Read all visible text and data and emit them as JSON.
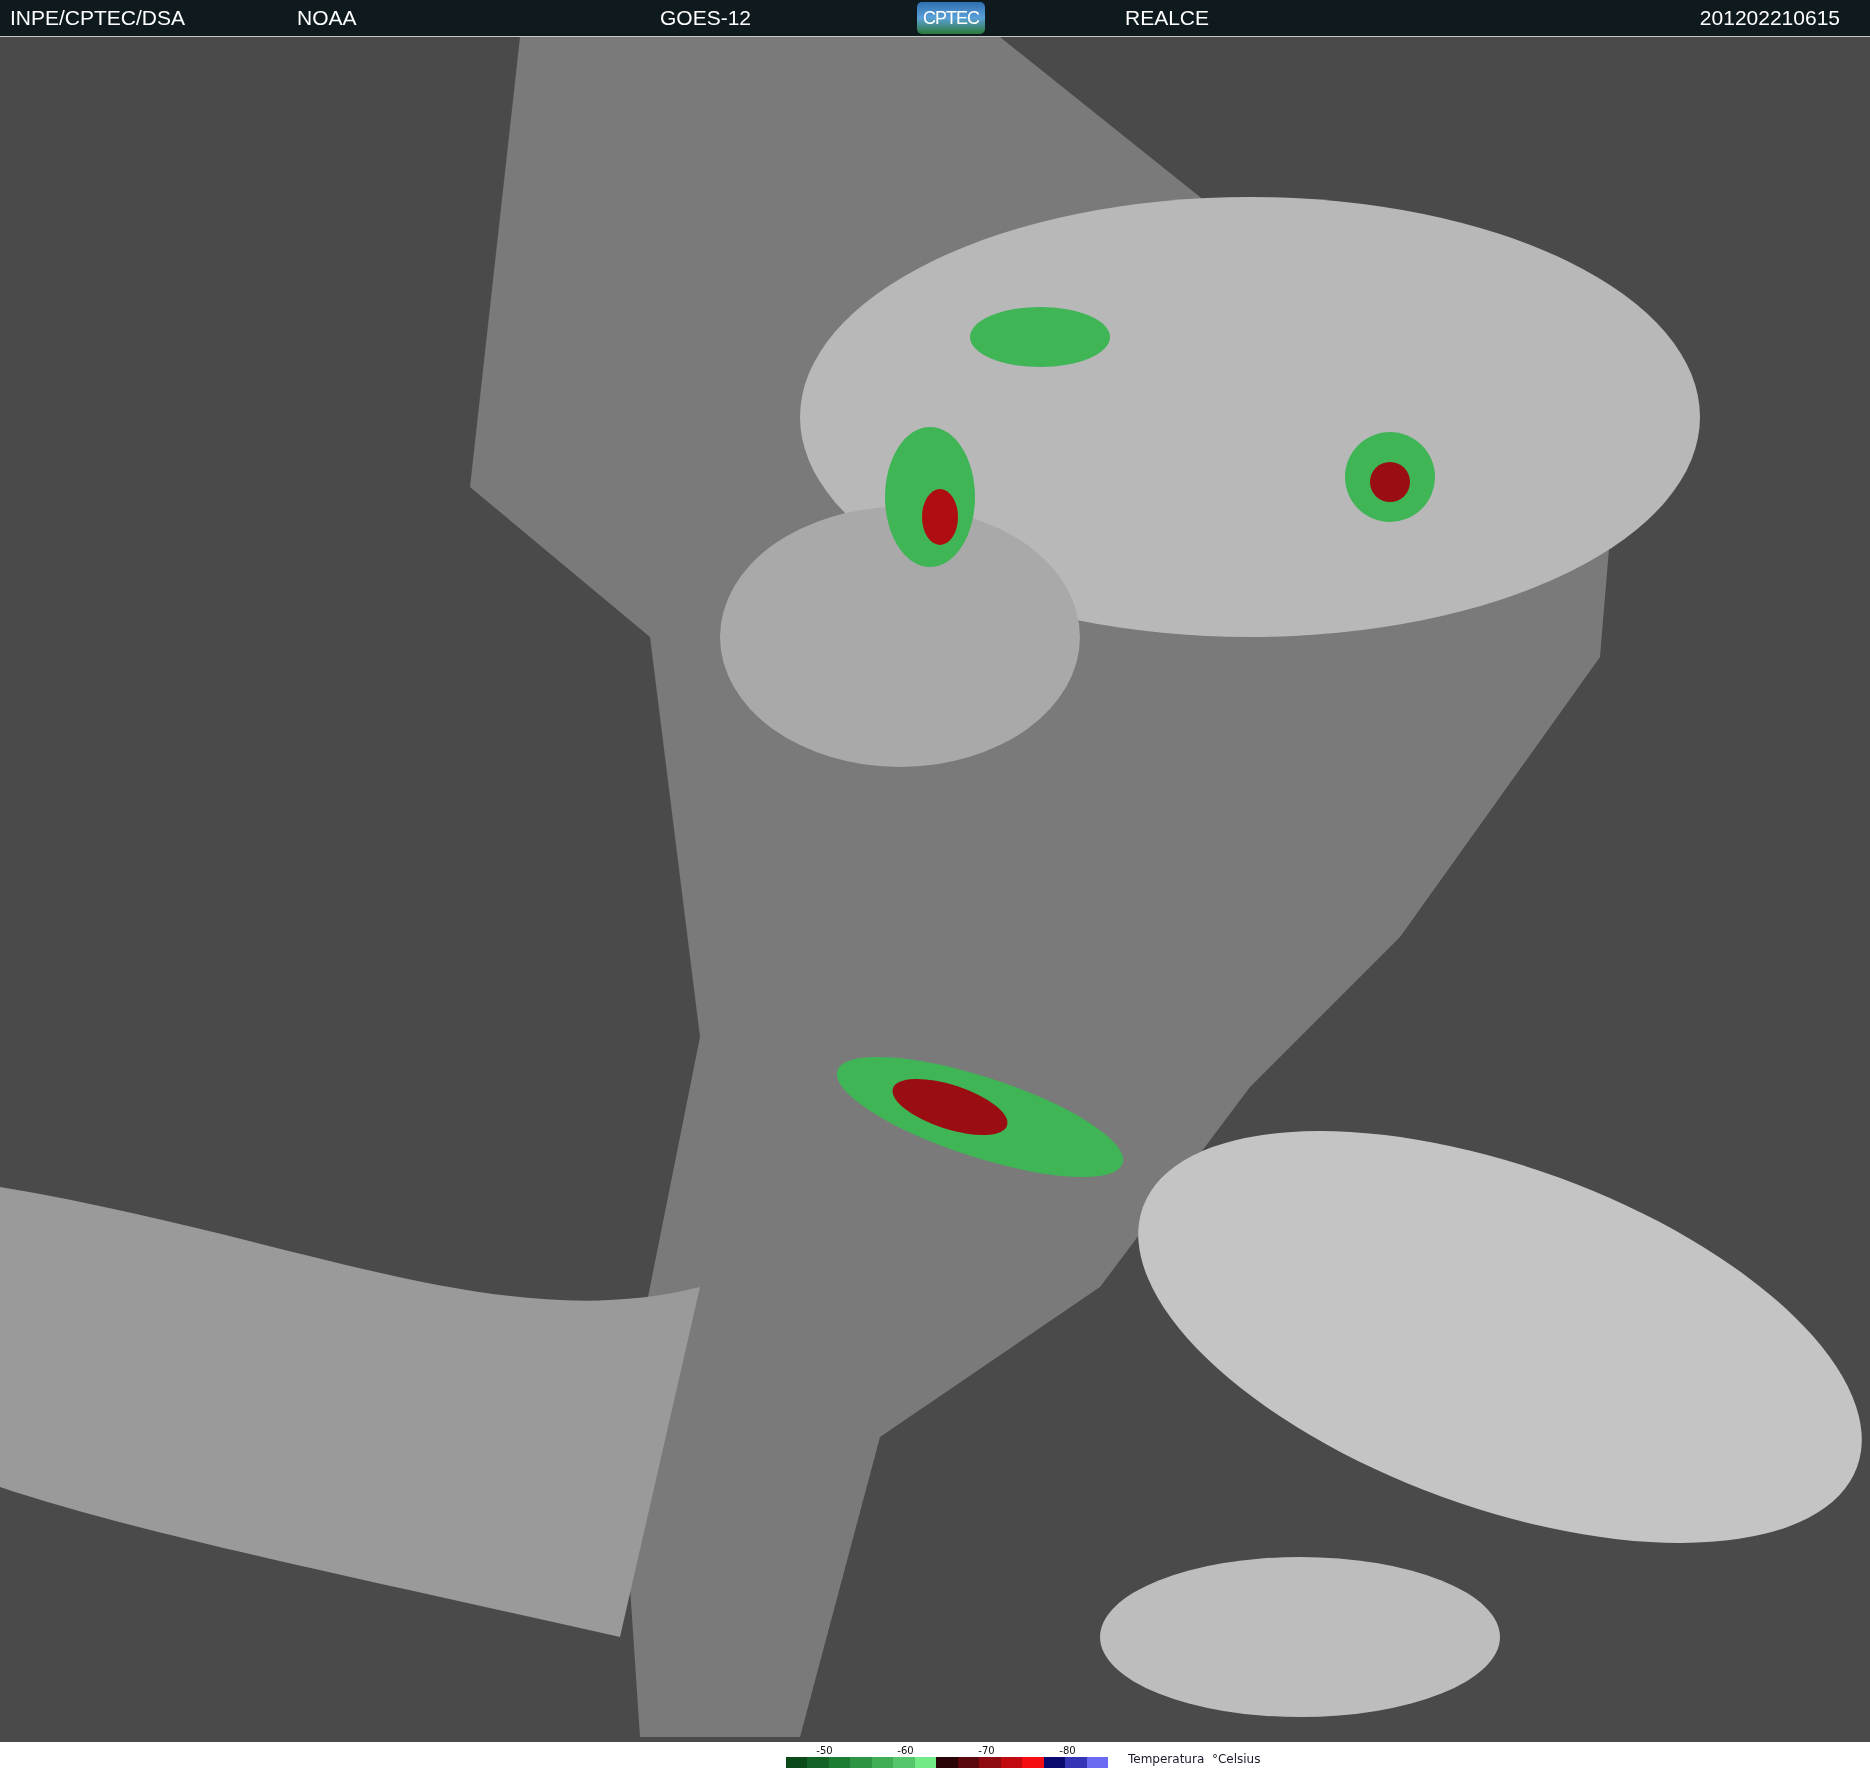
{
  "header": {
    "items": [
      {
        "kind": "text",
        "text": "INPE/CPTEC/DSA"
      },
      {
        "kind": "text",
        "text": "NOAA"
      },
      {
        "kind": "text",
        "text": "GOES-12"
      },
      {
        "kind": "logo",
        "text": "CPTEC"
      },
      {
        "kind": "text",
        "text": "REALCE"
      },
      {
        "kind": "date",
        "text": "201202210615"
      }
    ]
  },
  "legend": {
    "ticks": [
      "-50",
      "-60",
      "-70",
      "-80"
    ],
    "title": "Temperatura  °Celsius",
    "swatches": [
      {
        "color": "#0a4a1a"
      },
      {
        "color": "#136326"
      },
      {
        "color": "#1d7c33"
      },
      {
        "color": "#2c9443"
      },
      {
        "color": "#3fae55"
      },
      {
        "color": "#55c66b"
      },
      {
        "color": "#72ea86"
      },
      {
        "color": "#2a0508"
      },
      {
        "color": "#5a070d"
      },
      {
        "color": "#8c0a10"
      },
      {
        "color": "#c00a0f"
      },
      {
        "color": "#f50c10"
      },
      {
        "color": "#0a0a6e"
      },
      {
        "color": "#3434b4"
      },
      {
        "color": "#6a6af2"
      }
    ]
  }
}
